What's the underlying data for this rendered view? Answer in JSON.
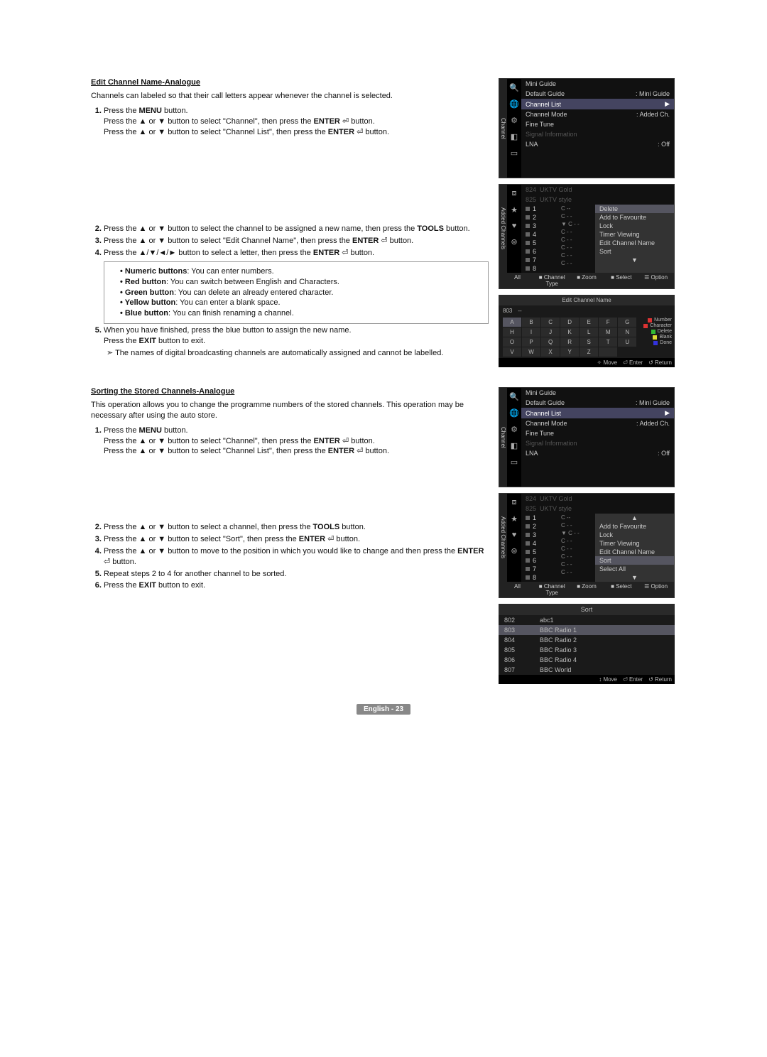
{
  "sectionA": {
    "title": "Edit Channel Name-Analogue",
    "intro": "Channels can labeled so that their call letters appear whenever the channel is selected.",
    "steps": {
      "s1_a": "Press the ",
      "s1_b": "MENU",
      "s1_c": " button.",
      "s1_d": "Press the ▲ or ▼ button to select \"Channel\", then press the ",
      "s1_e": "ENTER",
      "s1_f": " ⏎ button.",
      "s1_g": "Press the ▲ or ▼ button to select \"Channel List\", then press the ",
      "s1_h": "ENTER",
      "s1_i": " ⏎ button.",
      "s2_a": "Press the ▲ or ▼ button to select the channel to be assigned a new name, then press the ",
      "s2_b": "TOOLS",
      "s2_c": " button.",
      "s3_a": "Press the ▲ or ▼ button to select \"Edit Channel Name\", then press the ",
      "s3_b": "ENTER",
      "s3_c": " ⏎ button.",
      "s4_a": "Press the ▲/▼/◄/► button to select a letter, then press the ",
      "s4_b": "ENTER",
      "s4_c": " ⏎ button.",
      "b1_a": "Numeric buttons",
      "b1_b": ": You can enter numbers.",
      "b2_a": "Red button",
      "b2_b": ": You can switch between English and Characters.",
      "b3_a": "Green button",
      "b3_b": ": You can delete an already entered character.",
      "b4_a": "Yellow button",
      "b4_b": ": You can enter a blank space.",
      "b5_a": "Blue button",
      "b5_b": ": You can finish renaming a channel.",
      "s5_a": "When you have finished, press the blue button to assign the new name.",
      "s5_b": "Press the ",
      "s5_c": "EXIT",
      "s5_d": " button to exit.",
      "note": "The names of digital broadcasting channels are automatically assigned and cannot be labelled."
    }
  },
  "sectionB": {
    "title": "Sorting the Stored Channels-Analogue",
    "intro": "This operation allows you to change the programme numbers of the stored channels. This operation may be necessary after using the auto store.",
    "steps": {
      "s1_a": "Press the ",
      "s1_b": "MENU",
      "s1_c": " button.",
      "s1_d": "Press the ▲ or ▼ button to select \"Channel\", then press the ",
      "s1_e": "ENTER",
      "s1_f": " ⏎ button.",
      "s1_g": "Press the ▲ or ▼ button to select \"Channel List\", then press the ",
      "s1_h": "ENTER",
      "s1_i": " ⏎ button.",
      "s2_a": "Press the ▲ or ▼ button to select a channel, then press the ",
      "s2_b": "TOOLS",
      "s2_c": " button.",
      "s3_a": "Press the ▲ or ▼ button to select \"Sort\", then press the ",
      "s3_b": "ENTER",
      "s3_c": " ⏎ button.",
      "s4_a": "Press the ▲ or ▼ button to move to the position in which you would like to change and then press the ",
      "s4_b": "ENTER",
      "s4_c": " ⏎ button.",
      "s5": "Repeat steps 2 to 4 for another channel to be sorted.",
      "s6_a": "Press the ",
      "s6_b": "EXIT",
      "s6_c": " button to exit."
    }
  },
  "tvMenu": {
    "sideLabel": "Channel",
    "items": {
      "mini": "Mini Guide",
      "def": "Default Guide",
      "defv": ": Mini Guide",
      "cl": "Channel List",
      "cm": "Channel Mode",
      "cmv": ": Added Ch.",
      "ft": "Fine Tune",
      "si": "Signal Information",
      "lna": "LNA",
      "lnav": ": Off"
    }
  },
  "addedCh": {
    "sideLabel": "Added Channels",
    "top1n": "824",
    "top1t": "UKTV Gold",
    "top2n": "825",
    "top2t": "UKTV style",
    "ch": {
      "c1": "1",
      "c2": "2",
      "c3": "3",
      "c4": "4",
      "c5": "5",
      "c6": "6",
      "c7": "7",
      "c8": "8"
    },
    "cval": "C - -",
    "cval1": "C --",
    "optsA": {
      "o1": "Delete",
      "o2": "Add to Favourite",
      "o3": "Lock",
      "o4": "Timer Viewing",
      "o5": "Edit Channel Name",
      "o6": "Sort"
    },
    "optsB": {
      "o0": "▲",
      "o1": "Add to Favourite",
      "o2": "Lock",
      "o3": "Timer Viewing",
      "o4": "Edit Channel Name",
      "o5": "Sort",
      "o6": "Select All",
      "o7": "▼"
    },
    "foot": {
      "f1": "All",
      "f2": "Channel Type",
      "f3": "Zoom",
      "f4": "Select",
      "f5": "Option"
    }
  },
  "editName": {
    "title": "Edit Channel Name",
    "num": "803",
    "dash": "--",
    "letters": [
      "A",
      "B",
      "C",
      "D",
      "E",
      "F",
      "G",
      "H",
      "I",
      "J",
      "K",
      "L",
      "M",
      "N",
      "O",
      "P",
      "Q",
      "R",
      "S",
      "T",
      "U",
      "V",
      "W",
      "X",
      "Y",
      "Z",
      ""
    ],
    "legend": {
      "num": "Number",
      "char": "Character",
      "del": "Delete",
      "blank": "Blank",
      "done": "Done"
    },
    "foot": {
      "move": "Move",
      "enter": "⏎ Enter",
      "ret": "↺ Return"
    }
  },
  "sort": {
    "title": "Sort",
    "rows": [
      {
        "n": "802",
        "t": "abc1"
      },
      {
        "n": "803",
        "t": "BBC Radio 1"
      },
      {
        "n": "804",
        "t": "BBC Radio 2"
      },
      {
        "n": "805",
        "t": "BBC Radio 3"
      },
      {
        "n": "806",
        "t": "BBC Radio 4"
      },
      {
        "n": "807",
        "t": "BBC World"
      }
    ],
    "foot": {
      "move": "↕ Move",
      "enter": "⏎ Enter",
      "ret": "↺ Return"
    }
  },
  "footer": "English - 23"
}
